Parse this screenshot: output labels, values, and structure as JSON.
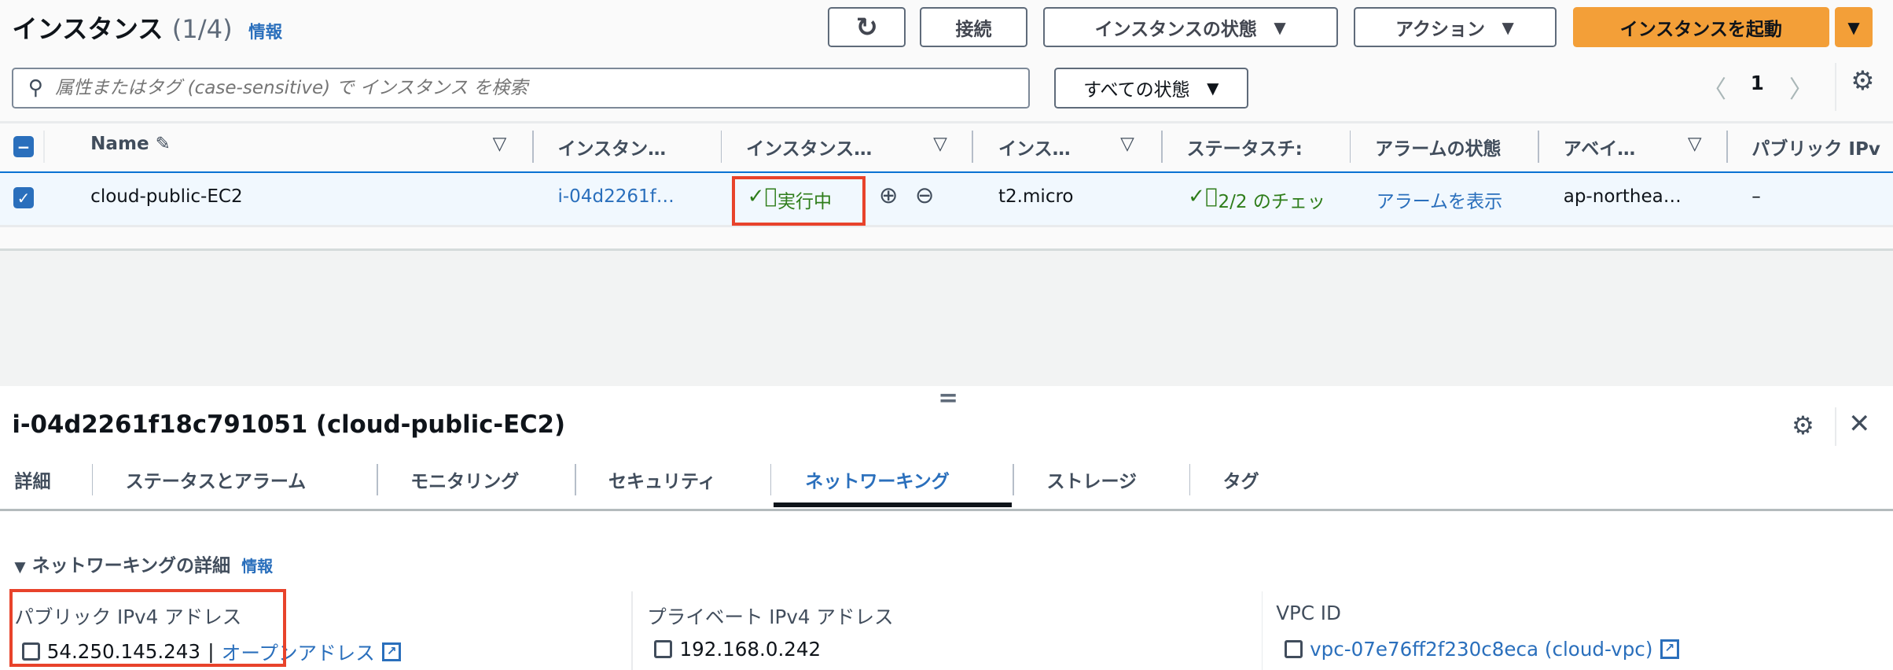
{
  "header": {
    "title": "インスタンス",
    "count": "(1/4)",
    "info": "情報"
  },
  "toolbar": {
    "refresh_icon": "refresh-icon",
    "connect": "接続",
    "instance_state": "インスタンスの状態",
    "actions": "アクション",
    "launch": "インスタンスを起動",
    "dropdown_arrow": "▼"
  },
  "search": {
    "placeholder": "属性またはタグ (case-sensitive) で インスタンス を検索"
  },
  "state_filter": {
    "selected": "すべての状態"
  },
  "pagination": {
    "page": "1",
    "prev": "〈",
    "next": "〉"
  },
  "table": {
    "columns": [
      "Name",
      "インスタン…",
      "インスタンス…",
      "インス…",
      "ステータスチ:",
      "アラームの状態",
      "アベイ…",
      "パブリック IPv"
    ],
    "rows": [
      {
        "name": "cloud-public-EC2",
        "instance_id": "i-04d2261f…",
        "state": "実行中",
        "type": "t2.micro",
        "status_check": "2/2 のチェッ",
        "alarm": "アラームを表示",
        "az": "ap-northea…",
        "public_ip": "–"
      }
    ]
  },
  "detail": {
    "handle": "=",
    "title": "i-04d2261f18c791051 (cloud-public-EC2)",
    "tabs": [
      "詳細",
      "ステータスとアラーム",
      "モニタリング",
      "セキュリティ",
      "ネットワーキング",
      "ストレージ",
      "タグ"
    ],
    "active_tab": "ネットワーキング",
    "section": "ネットワーキングの詳細",
    "section_info": "情報",
    "public_ipv4_label": "パブリック IPv4 アドレス",
    "public_ipv4": "54.250.145.243",
    "open_address": "オープンアドレス",
    "private_ipv4_label": "プライベート IPv4 アドレス",
    "private_ipv4": "192.168.0.242",
    "vpc_label": "VPC ID",
    "vpc_id": "vpc-07e76ff2f230c8eca (cloud-vpc)"
  },
  "colors": {
    "accent": "#2a6fbc",
    "launch": "#f39f38",
    "running": "#2e7d1a",
    "highlight": "#e8432b"
  }
}
